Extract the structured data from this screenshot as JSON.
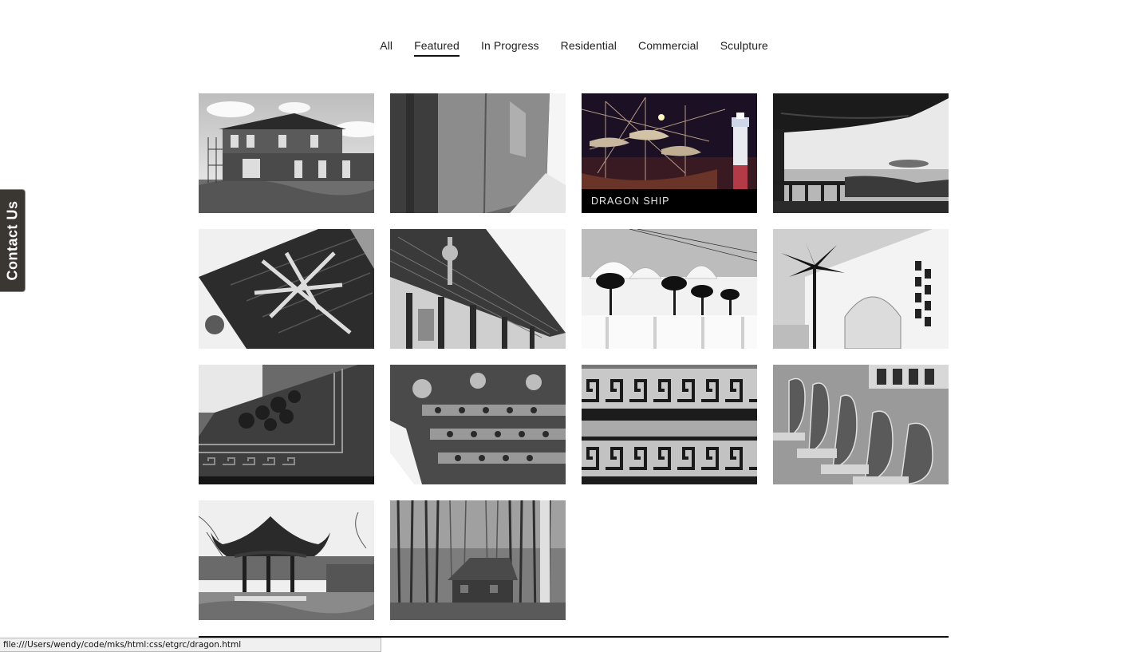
{
  "nav": {
    "filters": [
      "All",
      "Featured",
      "In Progress",
      "Residential",
      "Commercial",
      "Sculpture"
    ],
    "active": "Featured"
  },
  "contact_tab": {
    "label": "Contact Us"
  },
  "gallery": {
    "tiles": [
      {
        "subject": "house-under-construction",
        "tone": "grayscale"
      },
      {
        "subject": "concrete-wall",
        "tone": "grayscale"
      },
      {
        "subject": "dragon-ship",
        "tone": "color",
        "caption": "DRAGON SHIP"
      },
      {
        "subject": "pagoda-roof-ocean",
        "tone": "grayscale"
      },
      {
        "subject": "roof-bracket-detail",
        "tone": "grayscale"
      },
      {
        "subject": "temple-eaves",
        "tone": "grayscale"
      },
      {
        "subject": "domed-palace-palms",
        "tone": "grayscale"
      },
      {
        "subject": "arched-gate-palm",
        "tone": "grayscale"
      },
      {
        "subject": "carved-panel-flowers",
        "tone": "grayscale"
      },
      {
        "subject": "ornate-carved-beams",
        "tone": "grayscale"
      },
      {
        "subject": "greek-key-fretwork",
        "tone": "grayscale"
      },
      {
        "subject": "bench-carvings-row",
        "tone": "grayscale"
      },
      {
        "subject": "pavilion-garden",
        "tone": "grayscale"
      },
      {
        "subject": "cabin-in-forest",
        "tone": "grayscale"
      }
    ]
  },
  "status_bar": {
    "url": "file:///Users/wendy/code/mks/html:css/etgrc/dragon.html"
  },
  "colors": {
    "text": "#222222",
    "contact_bg": "#3a3631",
    "caption_bg": "#000000"
  }
}
